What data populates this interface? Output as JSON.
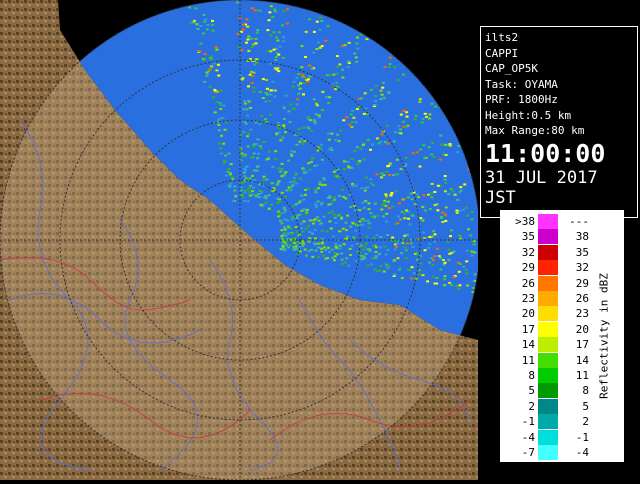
{
  "info": {
    "lines": [
      "ilts2",
      "CAPPI",
      "CAP_OP5K",
      "Task: OYAMA",
      "PRF: 1800Hz",
      "Height:0.5 km",
      "Max Range:80 km"
    ],
    "time": "11:00:00",
    "date": "31 JUL 2017 JST"
  },
  "legend": {
    "title": "Reflectivity in dBZ",
    "rows": [
      {
        "low": ">38",
        "high": "---",
        "color": "#ff33ff"
      },
      {
        "low": "35",
        "high": "38",
        "color": "#cc00cc"
      },
      {
        "low": "32",
        "high": "35",
        "color": "#cc0000"
      },
      {
        "low": "29",
        "high": "32",
        "color": "#ff2200"
      },
      {
        "low": "26",
        "high": "29",
        "color": "#ff7700"
      },
      {
        "low": "23",
        "high": "26",
        "color": "#ffaa00"
      },
      {
        "low": "20",
        "high": "23",
        "color": "#ffdd00"
      },
      {
        "low": "17",
        "high": "20",
        "color": "#ffff00"
      },
      {
        "low": "14",
        "high": "17",
        "color": "#bbee00"
      },
      {
        "low": "11",
        "high": "14",
        "color": "#44dd00"
      },
      {
        "low": "8",
        "high": "11",
        "color": "#00cc00"
      },
      {
        "low": "5",
        "high": "8",
        "color": "#009900"
      },
      {
        "low": "2",
        "high": "5",
        "color": "#008888"
      },
      {
        "low": "-1",
        "high": "2",
        "color": "#00aaaa"
      },
      {
        "low": "-4",
        "high": "-1",
        "color": "#00dddd"
      },
      {
        "low": "-7",
        "high": "-4",
        "color": "#44ffff"
      }
    ]
  },
  "colors": {
    "sea": "#2a6fe0",
    "land": "#8b6b43",
    "land_dark": "#5a4428",
    "range_rings": "#3b3b3b"
  },
  "icons": [
    "radar-echo",
    "rivers",
    "prefecture-borders"
  ]
}
